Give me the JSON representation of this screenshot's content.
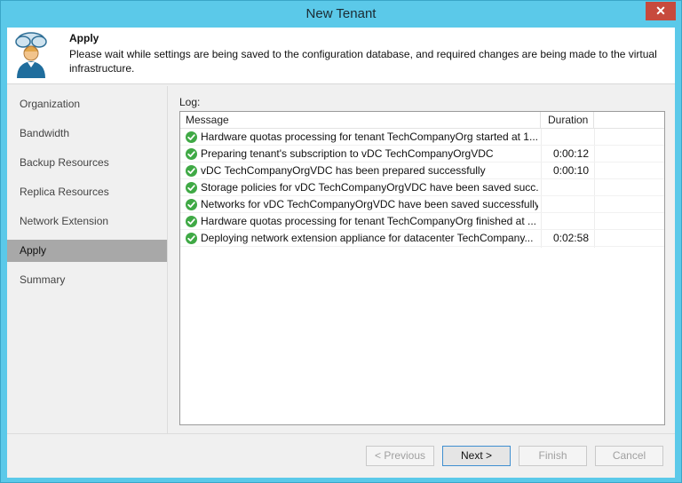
{
  "window": {
    "title": "New Tenant",
    "close_label": "✕"
  },
  "header": {
    "title": "Apply",
    "description": "Please wait while settings are being saved to the configuration database, and required changes are being made to the virtual infrastructure.",
    "icon": "user-cloud-icon"
  },
  "sidebar": {
    "items": [
      {
        "label": "Organization",
        "active": false
      },
      {
        "label": "Bandwidth",
        "active": false
      },
      {
        "label": "Backup Resources",
        "active": false
      },
      {
        "label": "Replica Resources",
        "active": false
      },
      {
        "label": "Network Extension",
        "active": false
      },
      {
        "label": "Apply",
        "active": true
      },
      {
        "label": "Summary",
        "active": false
      }
    ]
  },
  "log": {
    "label": "Log:",
    "columns": {
      "message": "Message",
      "duration": "Duration"
    },
    "rows": [
      {
        "message": "Hardware quotas processing for tenant TechCompanyOrg started at 1...",
        "duration": ""
      },
      {
        "message": "Preparing tenant's subscription to vDC TechCompanyOrgVDC",
        "duration": "0:00:12"
      },
      {
        "message": "vDC TechCompanyOrgVDC has been prepared successfully",
        "duration": "0:00:10"
      },
      {
        "message": "Storage policies for vDC TechCompanyOrgVDC have been saved succ...",
        "duration": ""
      },
      {
        "message": "Networks for vDC TechCompanyOrgVDC have been saved successfully",
        "duration": ""
      },
      {
        "message": "Hardware quotas processing for tenant TechCompanyOrg finished at ...",
        "duration": ""
      },
      {
        "message": "Deploying network extension appliance for datacenter TechCompany...",
        "duration": "0:02:58"
      }
    ],
    "status_icon": "success-check-icon",
    "status_color": "#3fa945"
  },
  "footer": {
    "previous_label": "< Previous",
    "next_label": "Next >",
    "finish_label": "Finish",
    "cancel_label": "Cancel"
  }
}
